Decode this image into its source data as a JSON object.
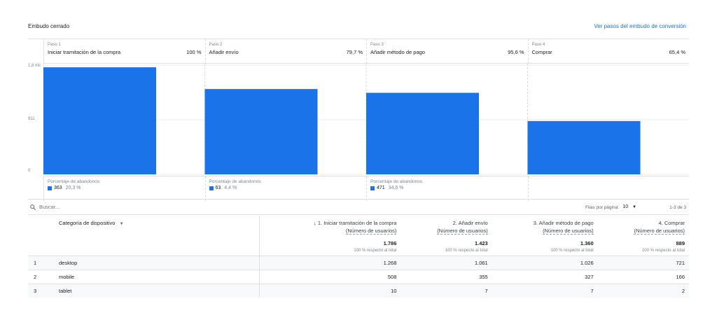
{
  "header": {
    "title": "Embudo cerrado",
    "link": "Ver pasos del embudo de conversión"
  },
  "chart_data": {
    "type": "bar",
    "categories": [
      "Iniciar tramitación de la compra",
      "Añadir envío",
      "Añadir método de pago",
      "Comprar"
    ],
    "values": [
      1786,
      1423,
      1360,
      889
    ],
    "ylim": [
      0,
      1822
    ],
    "yticks": [
      "0",
      "911",
      "1,8 mil"
    ],
    "ytick_values": [
      0,
      911,
      1822
    ],
    "grid": true,
    "steps": [
      {
        "num": "Paso 1",
        "name": "Iniciar tramitación de la compra",
        "pct": "100 %"
      },
      {
        "num": "Paso 2",
        "name": "Añadir envío",
        "pct": "79,7 %"
      },
      {
        "num": "Paso 3",
        "name": "Añadir método de pago",
        "pct": "95,6 %"
      },
      {
        "num": "Paso 4",
        "name": "Comprar",
        "pct": "65,4 %"
      }
    ],
    "abandon_label": "Porcentaje de abandonos",
    "abandons": [
      {
        "count": "363",
        "pct": "20,3 %"
      },
      {
        "count": "63",
        "pct": "4,4 %"
      },
      {
        "count": "471",
        "pct": "34,6 %"
      }
    ],
    "bar_color": "#1a73e8"
  },
  "toolbar": {
    "search_placeholder": "Buscar...",
    "rows_label": "Filas por página:",
    "rows_value": "10",
    "pager": "1-3 de 3"
  },
  "table": {
    "dimension": "Categoría de dispositivo",
    "metrics": [
      {
        "name": "↓ 1. Iniciar tramitación de la compra",
        "sub": "(Número de usuarios)"
      },
      {
        "name": "2. Añadir envío",
        "sub": "(Número de usuarios)"
      },
      {
        "name": "3. Añadir método de pago",
        "sub": "(Número de usuarios)"
      },
      {
        "name": "4. Comprar",
        "sub": "(Número de usuarios)"
      }
    ],
    "totals": [
      "1.786",
      "1.423",
      "1.360",
      "889"
    ],
    "totals_sub": "100 % respecto al total",
    "rows": [
      {
        "idx": "1",
        "dim": "desktop",
        "vals": [
          "1.268",
          "1.061",
          "1.026",
          "721"
        ]
      },
      {
        "idx": "2",
        "dim": "mobile",
        "vals": [
          "508",
          "355",
          "327",
          "166"
        ]
      },
      {
        "idx": "3",
        "dim": "tablet",
        "vals": [
          "10",
          "7",
          "7",
          "2"
        ]
      }
    ]
  }
}
